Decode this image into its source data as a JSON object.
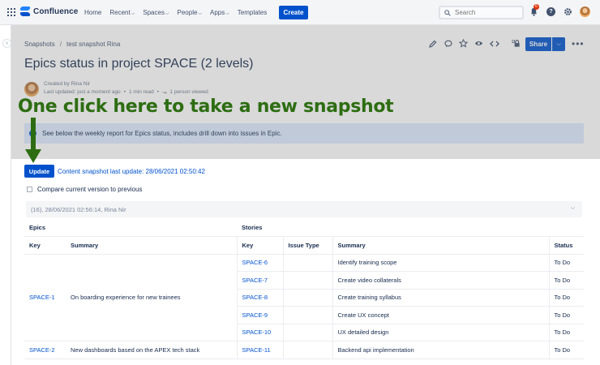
{
  "topnav": {
    "app_name": "Confluence",
    "links": [
      {
        "label": "Home",
        "dropdown": false
      },
      {
        "label": "Recent",
        "dropdown": true
      },
      {
        "label": "Spaces",
        "dropdown": true
      },
      {
        "label": "People",
        "dropdown": true
      },
      {
        "label": "Apps",
        "dropdown": true
      },
      {
        "label": "Templates",
        "dropdown": false
      }
    ],
    "create_label": "Create",
    "search_placeholder": "Search",
    "notification_count": "6",
    "help_glyph": "?",
    "icons": [
      "app-switcher-icon",
      "confluence-logo-icon",
      "search-icon",
      "bell-icon",
      "help-icon",
      "gear-icon",
      "avatar"
    ]
  },
  "sidebar": {
    "expand_glyph": "›"
  },
  "breadcrumb": {
    "items": [
      "Snapshots",
      "test snapshot Rina"
    ],
    "separator": "/"
  },
  "page_actions": {
    "icons": [
      "edit-icon",
      "comment-icon",
      "star-icon",
      "watch-icon",
      "source-icon",
      "restrictions-icon"
    ],
    "share_label": "Share",
    "more_glyph": "•••"
  },
  "page": {
    "title": "Epics status in project SPACE (2 levels)",
    "created_by": "Created by Rina Nir",
    "last_updated": "Last updated: just a moment ago",
    "read_time": "1 min read",
    "viewed": "1 person viewed",
    "bullet": "•"
  },
  "info_panel": {
    "text": "See below the weekly report for Epics status, includes drill down into issues in Epic."
  },
  "annotation": {
    "text": "One click here to take a new snapshot",
    "color": "#2d6d12"
  },
  "macro": {
    "update_label": "Update",
    "snapshot_text": "Content snapshot last update: 28/06/2021 02:50:42",
    "compare_label": "Compare current version to previous",
    "version_value": "(16), 28/06/2021 02:56:14, Rina Nir"
  },
  "table": {
    "group_headers": {
      "epics": "Epics",
      "stories": "Stories"
    },
    "columns": {
      "epic_key": "Key",
      "epic_summary": "Summary",
      "story_key": "Key",
      "issue_type": "Issue Type",
      "story_summary": "Summary",
      "status": "Status"
    },
    "epics": [
      {
        "key": "SPACE-1",
        "summary": "On boarding experience for new trainees"
      },
      {
        "key": "SPACE-2",
        "summary": "New dashboards based on the APEX tech stack"
      }
    ],
    "stories": [
      {
        "key": "SPACE-6",
        "type": "",
        "summary": "Identify training scope",
        "status": "To Do"
      },
      {
        "key": "SPACE-7",
        "type": "",
        "summary": "Create video collaterals",
        "status": "To Do"
      },
      {
        "key": "SPACE-8",
        "type": "",
        "summary": "Create training syllabus",
        "status": "To Do"
      },
      {
        "key": "SPACE-9",
        "type": "",
        "summary": "Create UX concept",
        "status": "To Do"
      },
      {
        "key": "SPACE-10",
        "type": "",
        "summary": "UX detailed design",
        "status": "To Do"
      },
      {
        "key": "SPACE-11",
        "type": "",
        "summary": "Backend api implementation",
        "status": "To Do"
      }
    ]
  },
  "colors": {
    "brand": "#0052cc",
    "info_bg": "#deebff",
    "annotation": "#2d6d12"
  }
}
